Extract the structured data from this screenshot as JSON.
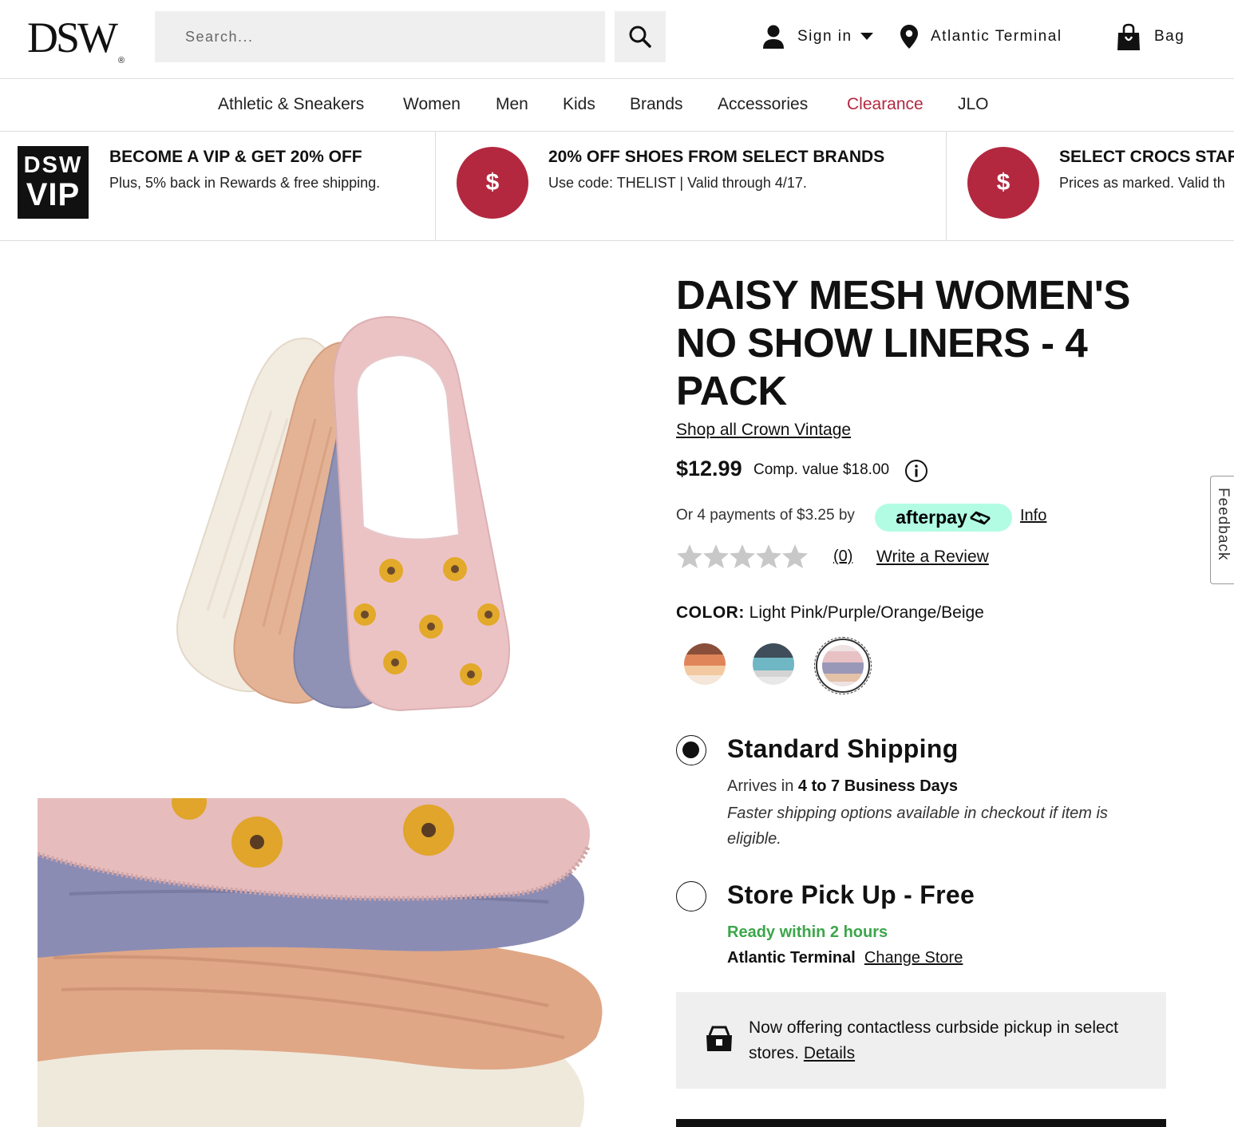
{
  "header": {
    "logo": "DSW",
    "logo_mark": "®",
    "search_placeholder": "Search...",
    "sign_in": "Sign in",
    "store": "Atlantic Terminal",
    "bag": "Bag"
  },
  "nav": [
    "Athletic & Sneakers",
    "Women",
    "Men",
    "Kids",
    "Brands",
    "Accessories",
    "Clearance",
    "JLO"
  ],
  "promos": [
    {
      "badge_top": "DSW",
      "badge_bottom": "VIP",
      "title": "BECOME A VIP & GET 20% OFF",
      "sub": "Plus, 5% back in Rewards & free shipping."
    },
    {
      "badge": "$",
      "title": "20% OFF SHOES FROM SELECT BRANDS",
      "sub": "Use code: THELIST | Valid through 4/17."
    },
    {
      "badge": "$",
      "title": "SELECT CROCS STAR",
      "sub": "Prices as marked. Valid th"
    }
  ],
  "product": {
    "title": "DAISY MESH WOMEN'S NO SHOW LINERS - 4 PACK",
    "shop_all": "Shop all Crown Vintage",
    "price": "$12.99",
    "comp_value": "Comp. value $18.00",
    "afterpay_text": "Or 4 payments of $3.25 by",
    "afterpay_brand": "afterpay",
    "afterpay_info": "Info",
    "rating": 0,
    "review_count": "(0)",
    "write_review": "Write a Review",
    "color_label": "COLOR:",
    "color_value": "Light Pink/Purple/Orange/Beige"
  },
  "shipping": {
    "standard_title": "Standard Shipping",
    "standard_arrives_prefix": "Arrives in",
    "standard_arrives_bold": "4 to 7 Business Days",
    "standard_note": "Faster shipping options available in checkout if item is eligible.",
    "pickup_title": "Store Pick Up - Free",
    "pickup_ready": "Ready within 2 hours",
    "pickup_store": "Atlantic Terminal",
    "change_store": "Change Store"
  },
  "curbside": {
    "text": "Now offering contactless curbside pickup in select stores.",
    "details": "Details"
  },
  "feedback": "Feedback",
  "colors": {
    "accent_red": "#b3283f",
    "afterpay_mint": "#b2fce4",
    "ready_green": "#3ca64a"
  }
}
